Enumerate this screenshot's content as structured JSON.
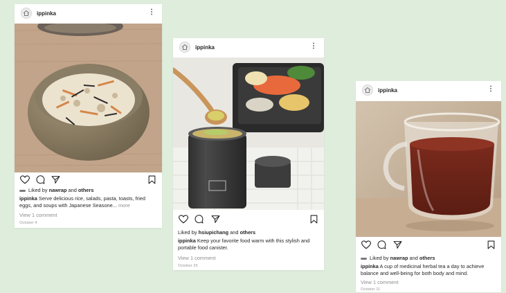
{
  "posts": [
    {
      "username": "ippinka",
      "liked_prefix": "Liked by ",
      "liked_user": "nawrap",
      "liked_mid": " and ",
      "liked_others": "others",
      "caption_user": "ippinka",
      "caption": " Serve delicious rice, salads, pasta, toasts, fried eggs, and soups with Japanese Seasone...",
      "more_label": " more",
      "view_comments": "View 1 comment",
      "date": "October 4",
      "icons": [
        "heart-icon",
        "comment-icon",
        "share-icon",
        "bookmark-icon",
        "more-icon"
      ]
    },
    {
      "username": "ippinka",
      "liked_prefix": "Liked by ",
      "liked_user": "hsiupichang",
      "liked_mid": " and ",
      "liked_others": "others",
      "caption_user": "ippinka",
      "caption": " Keep your favorite food warm with this stylish and portable food canister.",
      "view_comments": "View 1 comment",
      "date": "October 25",
      "icons": [
        "heart-icon",
        "comment-icon",
        "share-icon",
        "bookmark-icon",
        "more-icon"
      ]
    },
    {
      "username": "ippinka",
      "liked_prefix": "Liked by ",
      "liked_user": "nawrap",
      "liked_mid": " and ",
      "liked_others": "others",
      "caption_user": "ippinka",
      "caption": " A cup of medicinal herbal tea a day to achieve balance and well-being for both body and mind.",
      "view_comments": "View 1 comment",
      "date": "October 11",
      "icons": [
        "heart-icon",
        "comment-icon",
        "share-icon",
        "bookmark-icon",
        "more-icon"
      ]
    }
  ],
  "colors": {
    "background": "#dfeddc",
    "card": "#ffffff",
    "muted": "#8e8e8e"
  }
}
